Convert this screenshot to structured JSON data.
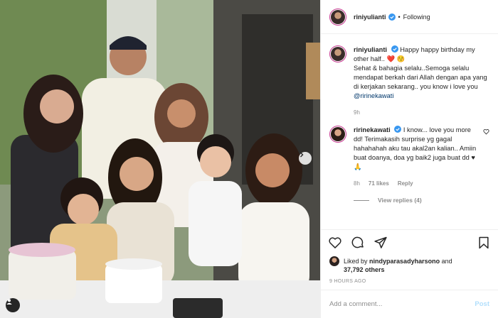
{
  "header": {
    "username": "riniyulianti",
    "follow_state": "Following",
    "separator": "•"
  },
  "caption": {
    "username": "riniyulianti",
    "text_line1": "Happy happy birthday my other half..",
    "heart": "❤️",
    "emoji_smile": "😚",
    "text_line2": "Sehat & bahagia selalu..Semoga selalu mendapat berkah dari Allah dengan apa yang di kerjakan sekarang.. you know i love you",
    "mention": "@ririnekawati",
    "time": "9h"
  },
  "comment": {
    "username": "ririnekawati",
    "text": "I know... love you more dd! Terimakasih surprise yg gagal hahahahah aku tau akal2an kalian.. Amiin buat doanya, doa yg baik2 juga buat dd ♥",
    "emoji_pray": "🙏",
    "time": "8h",
    "likes": "71 likes",
    "reply": "Reply",
    "view_replies": "View replies (4)"
  },
  "likes": {
    "liked_by_prefix": "Liked by",
    "liked_by_user": "nindyparasadyharsono",
    "and": "and",
    "count": "37,792 others"
  },
  "post_time": "9 HOURS AGO",
  "add_comment": {
    "placeholder": "Add a comment...",
    "post_label": "Post"
  },
  "colors": {
    "link": "#00376b",
    "verified": "#3897f0",
    "muted": "#8e8e8e",
    "post_disabled": "#b2dffc"
  },
  "icons": [
    "verified-icon",
    "heart-icon",
    "comment-icon",
    "share-icon",
    "bookmark-icon",
    "chevron-right-icon",
    "user-tag-icon"
  ]
}
